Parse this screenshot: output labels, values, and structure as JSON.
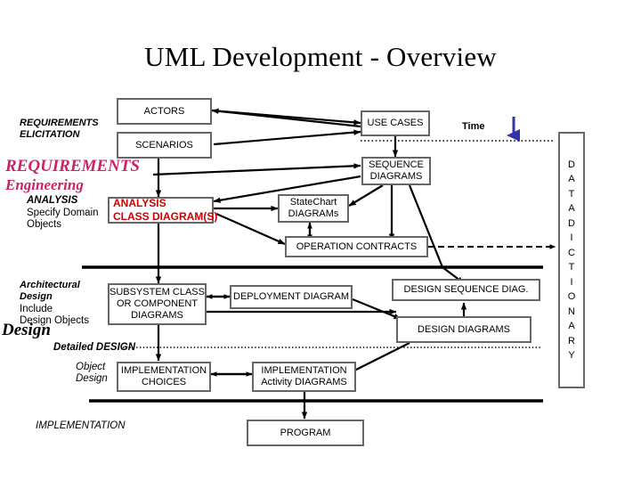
{
  "title": "UML Development - Overview",
  "phases": {
    "requirements_elicitation_line1": "REQUIREMENTS",
    "requirements_elicitation_line2": "ELICITATION",
    "requirements_engineering_line1": "REQUIREMENTS",
    "requirements_engineering_line2": "Engineering",
    "analysis_heading": "ANALYSIS",
    "analysis_sub1": "Specify Domain",
    "analysis_sub2": "Objects",
    "architectural_design_line1": "Architectural",
    "architectural_design_line2": "Design",
    "architectural_design_sub1": "Include",
    "architectural_design_sub2": "Design Objects",
    "design_heading": "Design",
    "detailed_design": "Detailed DESIGN",
    "object_design_line1": "Object",
    "object_design_line2": "Design",
    "implementation_heading": "IMPLEMENTATION"
  },
  "time_label": "Time",
  "boxes": {
    "actors": "ACTORS",
    "scenarios": "SCENARIOS",
    "use_cases": "USE CASES",
    "sequence_diagrams_l1": "SEQUENCE",
    "sequence_diagrams_l2": "DIAGRAMS",
    "analysis_class_l1": "ANALYSIS",
    "analysis_class_l2": "CLASS DIAGRAM(S)",
    "statechart_l1": "StateChart",
    "statechart_l2": "DIAGRAMs",
    "operation_contracts": "OPERATION CONTRACTS",
    "subsystem_l1": "SUBSYSTEM CLASS",
    "subsystem_l2": "OR COMPONENT",
    "subsystem_l3": "DIAGRAMS",
    "deployment_diagram": "DEPLOYMENT DIAGRAM",
    "design_sequence_diag": "DESIGN SEQUENCE  DIAG.",
    "design_diagrams": "DESIGN  DIAGRAMS",
    "implementation_choices_l1": "IMPLEMENTATION",
    "implementation_choices_l2": "CHOICES",
    "implementation_activity_l1": "IMPLEMENTATION",
    "implementation_activity_l2": "Activity DIAGRAMS",
    "program": "PROGRAM"
  },
  "data_dictionary": {
    "chars": [
      "D",
      "A",
      "T",
      "A",
      " ",
      "D",
      "I",
      "C",
      "T",
      "I",
      "O",
      "N",
      "A",
      "R",
      "Y"
    ],
    "text": "DATA DICTIONARY"
  },
  "colors": {
    "box_border": "#666666",
    "red_text": "#CC0000",
    "pink_heading": "#CC2266",
    "time_arrow": "#3333AA",
    "connector": "#000000",
    "background": "#FFFFFF"
  }
}
